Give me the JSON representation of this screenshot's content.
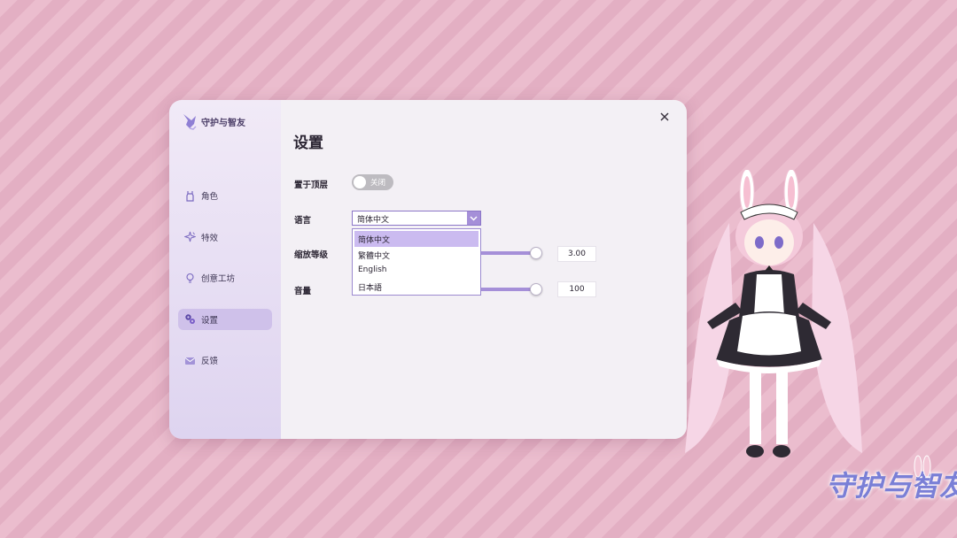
{
  "app": {
    "brand_name": "守护与智友"
  },
  "sidebar": {
    "items": [
      {
        "label": "角色",
        "icon": "dress-icon",
        "active": false
      },
      {
        "label": "特效",
        "icon": "sparkle-icon",
        "active": false
      },
      {
        "label": "创意工坊",
        "icon": "lightbulb-icon",
        "active": false
      },
      {
        "label": "设置",
        "icon": "gears-icon",
        "active": true
      },
      {
        "label": "反馈",
        "icon": "mail-icon",
        "active": false
      }
    ]
  },
  "settings": {
    "title": "设置",
    "always_on_top": {
      "label": "置于顶层",
      "state_text": "关闭",
      "enabled": false
    },
    "language": {
      "label": "语言",
      "selected": "简体中文",
      "options": [
        "简体中文",
        "繁體中文",
        "English",
        "日本語"
      ]
    },
    "scale": {
      "label": "缩放等级",
      "value_text": "3.00",
      "fraction": 0.97
    },
    "volume": {
      "label": "音量",
      "value_text": "100",
      "fraction": 0.97
    }
  },
  "colors": {
    "accent": "#a58fd8",
    "sidebar_active": "#cfc1ea",
    "background_pink": "#eab8cb"
  },
  "corner_logo": {
    "text": "守护与智友"
  }
}
